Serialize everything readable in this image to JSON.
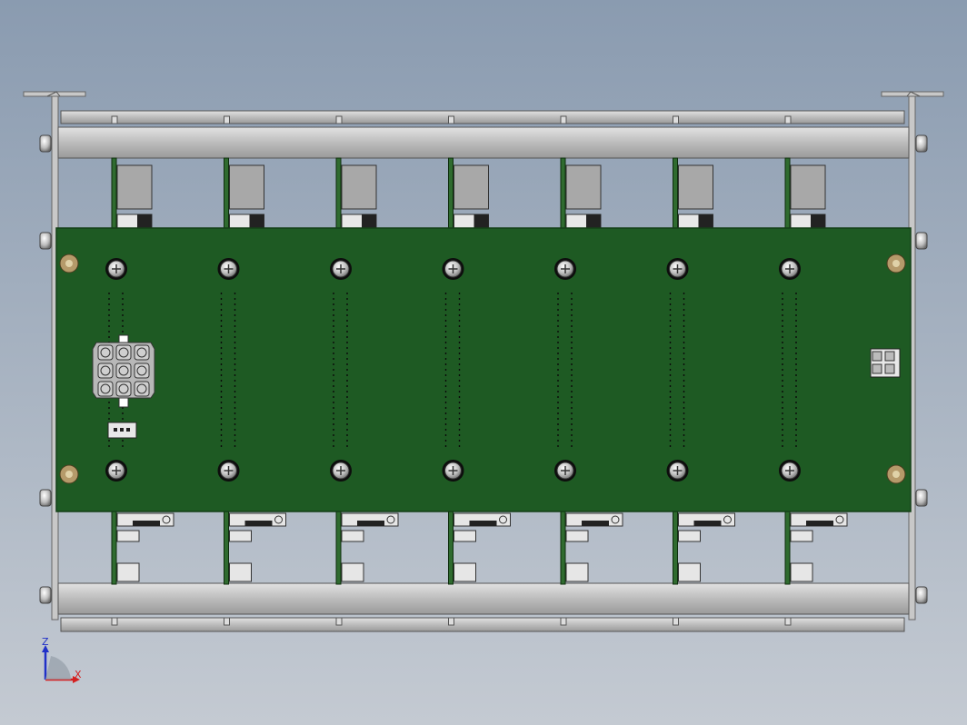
{
  "view": {
    "background_top": "#8a9bb0",
    "background_bottom": "#c4cad2"
  },
  "colors": {
    "frame": "#c8c8c8",
    "frame_dark": "#8e8e8e",
    "rail": "#bdbdbd",
    "pcb": "#1e5a23",
    "pcb_edge": "#143f18",
    "card": "#2f6b2f",
    "connector": "#b8b8b8",
    "screw": "#d4d4d4",
    "standoff": "#b59a6a",
    "axis_x": "#d42020",
    "axis_y": "#2aa02a",
    "axis_z": "#2030c8"
  },
  "board": {
    "slot_count": 7,
    "power_connector_pins": 9,
    "small_connector_pins": 3,
    "right_connector_pins": 4
  },
  "triad": {
    "x_label": "X",
    "z_label": "Z"
  }
}
